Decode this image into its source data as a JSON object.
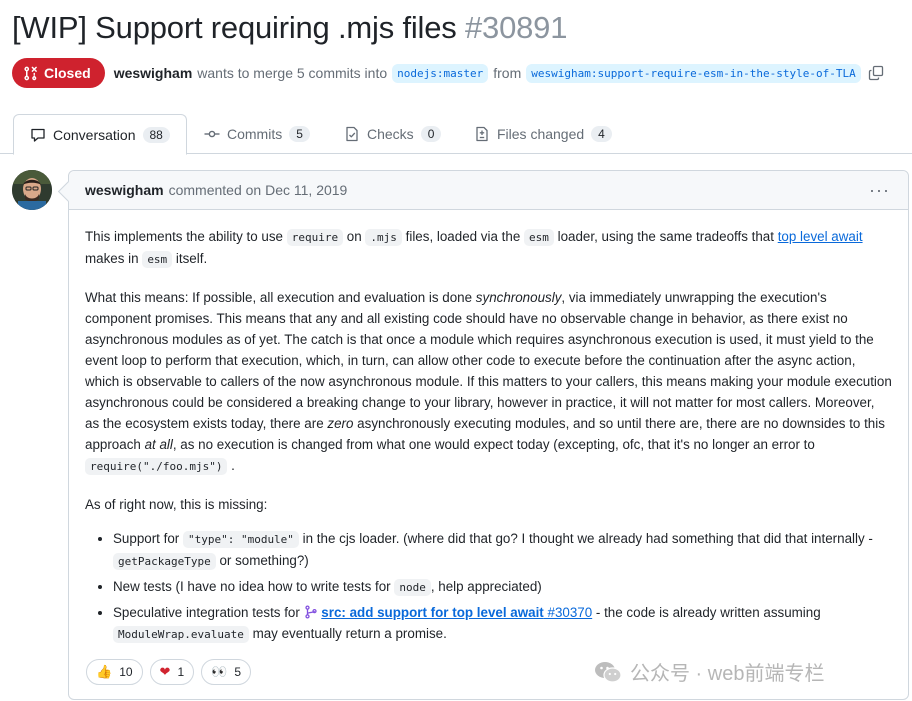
{
  "pr": {
    "title": "[WIP] Support requiring .mjs files",
    "number": "#30891",
    "state": "Closed",
    "author": "weswigham",
    "merge_text": "wants to merge 5 commits into",
    "base_branch": "nodejs:master",
    "from_text": "from",
    "head_branch": "weswigham:support-require-esm-in-the-style-of-TLA"
  },
  "tabs": [
    {
      "label": "Conversation",
      "count": "88",
      "icon": "comment-icon"
    },
    {
      "label": "Commits",
      "count": "5",
      "icon": "commit-icon"
    },
    {
      "label": "Checks",
      "count": "0",
      "icon": "checklist-icon"
    },
    {
      "label": "Files changed",
      "count": "4",
      "icon": "file-diff-icon"
    }
  ],
  "comment": {
    "author": "weswigham",
    "meta": "commented on Dec 11, 2019",
    "more": "···",
    "p1": {
      "t1": "This implements the ability to use ",
      "c1": "require",
      "t2": " on ",
      "c2": ".mjs",
      "t3": " files, loaded via the ",
      "c3": "esm",
      "t4": " loader, using the same tradeoffs that ",
      "link": "top level await",
      "t5": " makes in ",
      "c4": "esm",
      "t6": " itself."
    },
    "p2": {
      "t1": "What this means: If possible, all execution and evaluation is done ",
      "em1": "synchronously",
      "t2": ", via immediately unwrapping the execution's component promises. This means that any and all existing code should have no observable change in behavior, as there exist no asynchronous modules as of yet. The catch is that once a module which requires asynchronous execution is used, it must yield to the event loop to perform that execution, which, in turn, can allow other code to execute before the continuation after the async action, which is observable to callers of the now asynchronous module. If this matters to your callers, this means making your module execution asynchronous could be considered a breaking change to your library, however in practice, it will not matter for most callers. Moreover, as the ecosystem exists today, there are ",
      "em2": "zero",
      "t3": " asynchronously executing modules, and so until there are, there are no downsides to this approach ",
      "em3": "at all",
      "t4": ", as no execution is changed from what one would expect today (excepting, ofc, that it's no longer an error to ",
      "c1": "require(\"./foo.mjs\")",
      "t5": " ."
    },
    "p3": "As of right now, this is missing:",
    "items": {
      "i1": {
        "t1": "Support for ",
        "c1": "\"type\": \"module\"",
        "t2": " in the cjs loader. (where did that go? I thought we already had something that did that internally - ",
        "c2": "getPackageType",
        "t3": " or something?)"
      },
      "i2": {
        "t1": "New tests (I have no idea how to write tests for ",
        "c1": "node",
        "t2": ", help appreciated)"
      },
      "i3": {
        "t1": "Speculative integration tests for ",
        "link": "src: add support for top level await",
        "ref": " #30370",
        "t2": " - the code is already written assuming ",
        "c1": "ModuleWrap.evaluate",
        "t3": " may eventually return a promise."
      }
    },
    "reactions": [
      {
        "emoji": "👍",
        "count": "10"
      },
      {
        "emoji": "❤",
        "count": "1"
      },
      {
        "emoji": "👀",
        "count": "5"
      }
    ]
  },
  "watermark": {
    "text": "公众号 · web前端专栏",
    "icon": "wechat-icon"
  },
  "colors": {
    "closed": "#cf222e",
    "link": "#0969da",
    "branch_bg": "#ddf4ff",
    "border": "#d0d7de"
  }
}
